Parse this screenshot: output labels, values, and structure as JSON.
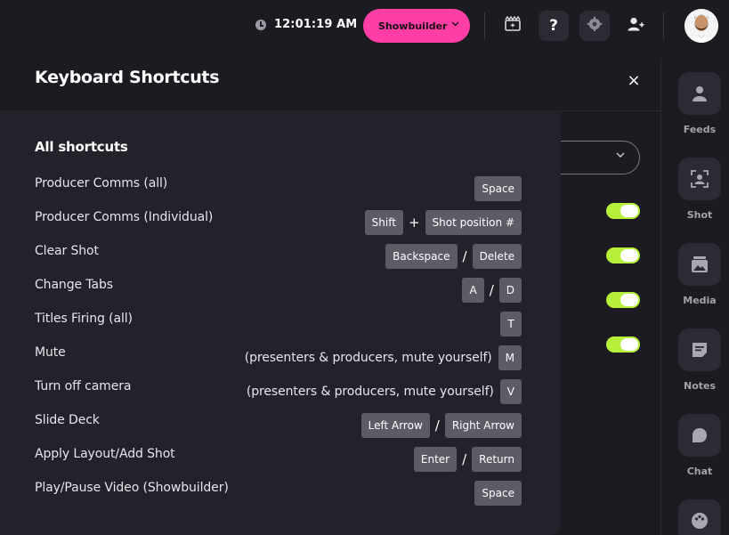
{
  "header": {
    "time": "12:01:19 AM",
    "mode_label": "Showbuilder",
    "icons": [
      "clock-icon",
      "scene-effects-icon",
      "help-icon",
      "settings-icon",
      "add-user-icon",
      "avatar"
    ]
  },
  "background": {
    "close_label": "×",
    "select_chevron": "⌄",
    "toggles_on": [
      true,
      true,
      true,
      true
    ],
    "accent_color": "#b7f03a"
  },
  "sidebar": {
    "items": [
      {
        "label": "Feeds",
        "icon": "feeds-icon"
      },
      {
        "label": "Shot",
        "icon": "shot-icon"
      },
      {
        "label": "Media",
        "icon": "media-icon"
      },
      {
        "label": "Notes",
        "icon": "notes-icon"
      },
      {
        "label": "Chat",
        "icon": "chat-icon"
      },
      {
        "label": "",
        "icon": "palette-icon"
      }
    ]
  },
  "modal": {
    "title": "Keyboard Shortcuts",
    "section_title": "All shortcuts",
    "shortcuts": [
      {
        "label": "Producer Comms (all)",
        "note": "",
        "keys": [
          "Space"
        ],
        "sep": ""
      },
      {
        "label": "Producer Comms (Individual)",
        "note": "",
        "keys": [
          "Shift",
          "Shot position #"
        ],
        "sep": "+"
      },
      {
        "label": "Clear Shot",
        "note": "",
        "keys": [
          "Backspace",
          "Delete"
        ],
        "sep": "/"
      },
      {
        "label": "Change Tabs",
        "note": "",
        "keys": [
          "A",
          "D"
        ],
        "sep": "/"
      },
      {
        "label": "Titles Firing (all)",
        "note": "",
        "keys": [
          "T"
        ],
        "sep": ""
      },
      {
        "label": "Mute",
        "note": "(presenters & producers, mute yourself)",
        "keys": [
          "M"
        ],
        "sep": ""
      },
      {
        "label": "Turn off camera",
        "note": "(presenters & producers, mute yourself)",
        "keys": [
          "V"
        ],
        "sep": ""
      },
      {
        "label": "Slide Deck",
        "note": "",
        "keys": [
          "Left Arrow",
          "Right Arrow"
        ],
        "sep": "/"
      },
      {
        "label": "Apply Layout/Add Shot",
        "note": "",
        "keys": [
          "Enter",
          "Return"
        ],
        "sep": "/"
      },
      {
        "label": "Play/Pause Video (Showbuilder)",
        "note": "",
        "keys": [
          "Space"
        ],
        "sep": ""
      }
    ]
  },
  "colors": {
    "brand_pink": "#ff3ea5",
    "key_bg": "#5c5b66",
    "modal_bg": "#23222b",
    "app_bg": "#1c1b21"
  }
}
